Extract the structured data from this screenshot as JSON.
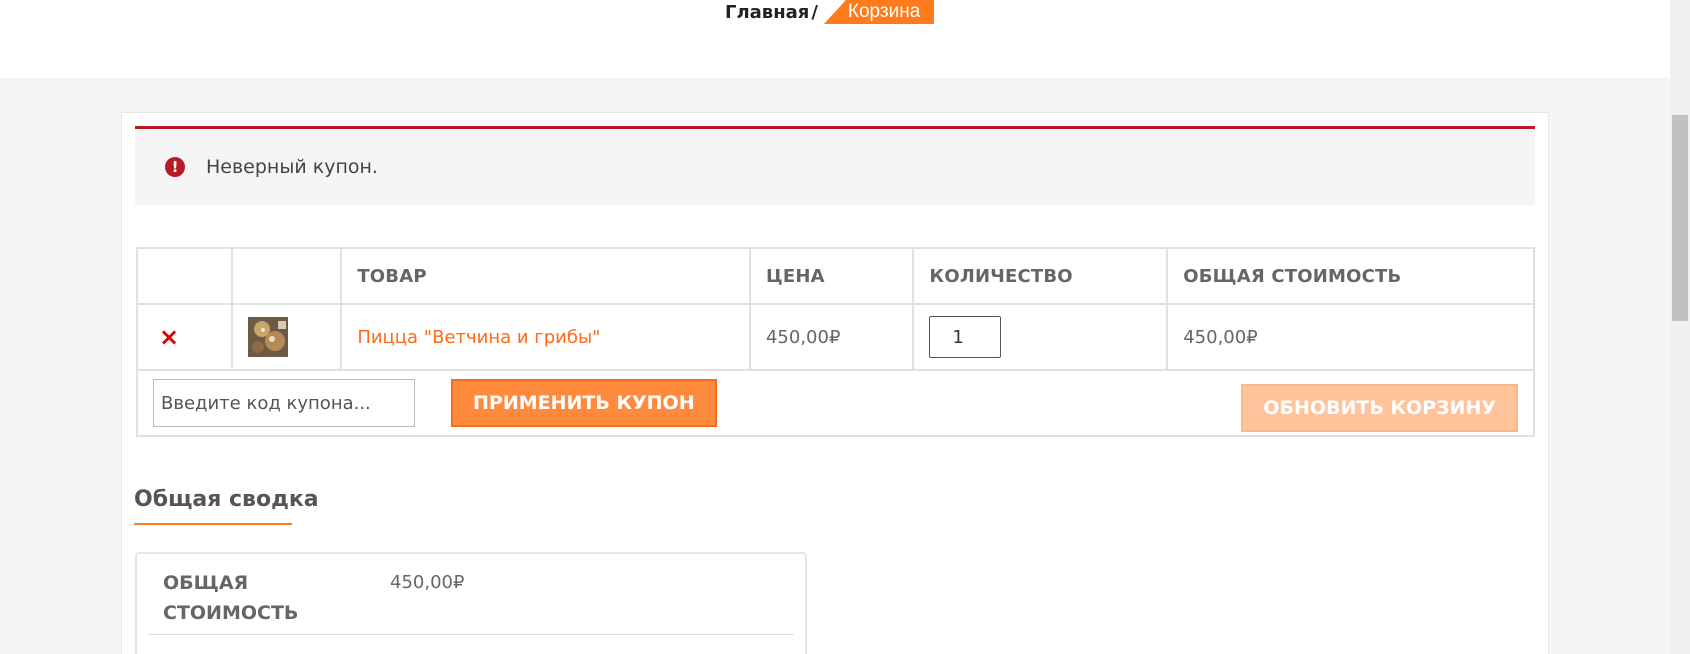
{
  "breadcrumb": {
    "home": "Главная",
    "separator": "/",
    "current": "Корзина"
  },
  "notice": {
    "icon": "exclamation-icon",
    "message": "Неверный купон."
  },
  "cart": {
    "headers": [
      "",
      "",
      "ТОВАР",
      "ЦЕНА",
      "КОЛИЧЕСТВО",
      "ОБЩАЯ СТОИМОСТЬ"
    ],
    "rows": [
      {
        "remove": "×",
        "image": "pizza-thumbnail",
        "product": "Пицца \"Ветчина и грибы\"",
        "price": "450,00₽",
        "quantity": "1",
        "total": "450,00₽"
      }
    ],
    "coupon_placeholder": "Введите код купона...",
    "apply_label": "ПРИМЕНИТЬ КУПОН",
    "update_label": "ОБНОВИТЬ КОРЗИНУ"
  },
  "summary": {
    "title": "Общая сводка",
    "total_label": "ОБЩАЯ СТОИМОСТЬ",
    "total_value": "450,00₽"
  },
  "colors": {
    "accent": "#ff7a1a",
    "error": "#b81c23",
    "remove": "#e00000"
  }
}
